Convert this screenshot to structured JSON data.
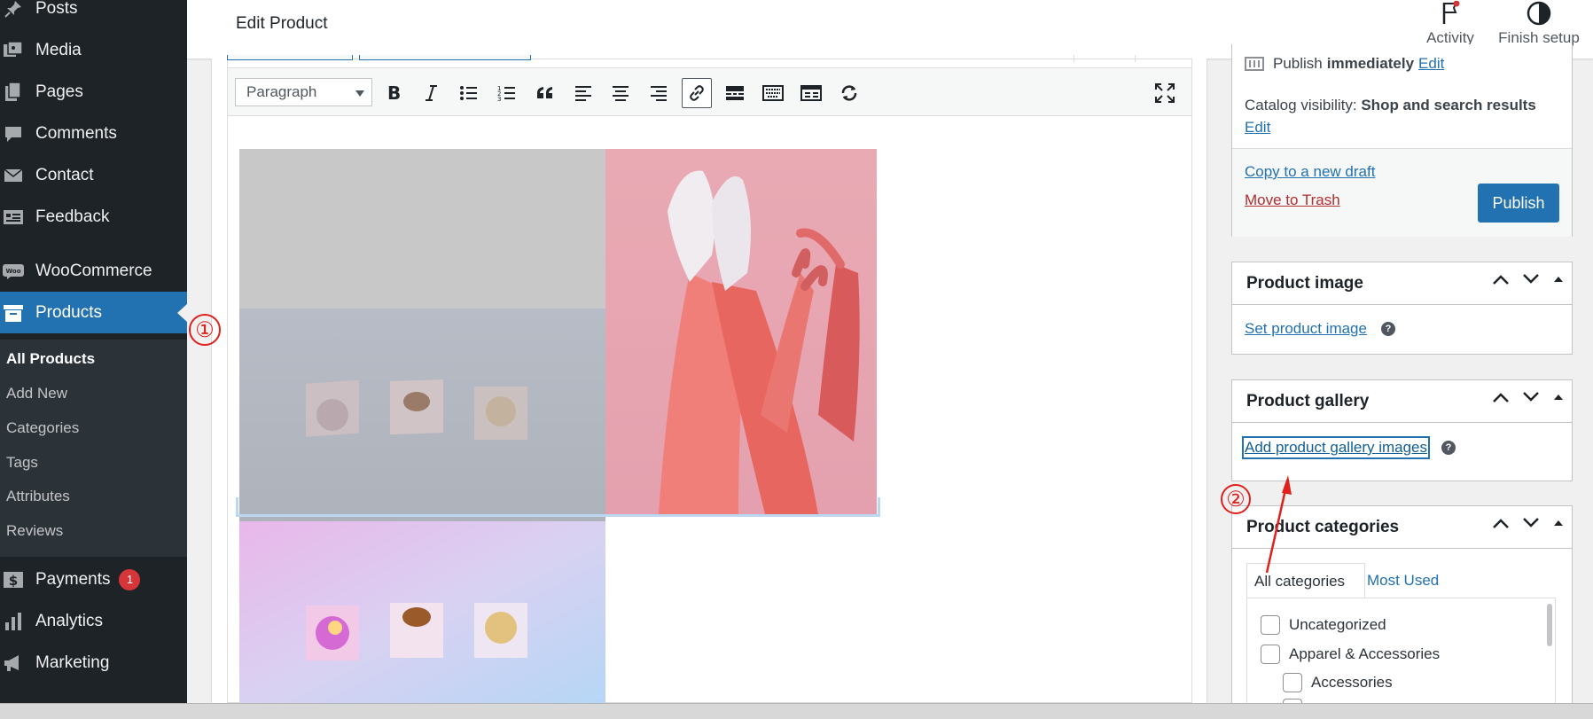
{
  "sidebar": {
    "items": [
      {
        "label": "Posts",
        "icon": "pin-icon"
      },
      {
        "label": "Media",
        "icon": "media-icon"
      },
      {
        "label": "Pages",
        "icon": "pages-icon"
      },
      {
        "label": "Comments",
        "icon": "comments-icon"
      },
      {
        "label": "Contact",
        "icon": "mail-icon"
      },
      {
        "label": "Feedback",
        "icon": "feedback-icon"
      },
      {
        "label": "WooCommerce",
        "icon": "woo-icon"
      },
      {
        "label": "Products",
        "icon": "archive-icon"
      },
      {
        "label": "Payments",
        "icon": "dollar-icon",
        "badge": "1"
      },
      {
        "label": "Analytics",
        "icon": "chart-icon"
      },
      {
        "label": "Marketing",
        "icon": "megaphone-icon"
      }
    ],
    "submenu": [
      "All Products",
      "Add New",
      "Categories",
      "Tags",
      "Attributes",
      "Reviews"
    ]
  },
  "topbar": {
    "title": "Edit Product",
    "activity": "Activity",
    "finish_setup": "Finish setup"
  },
  "editor": {
    "format_select": "Paragraph"
  },
  "publish": {
    "publish_label": "Publish",
    "immediately": "immediately",
    "edit": "Edit",
    "visibility_label": "Catalog visibility:",
    "visibility_value": "Shop and search results",
    "visibility_edit": "Edit",
    "copy_draft": "Copy to a new draft",
    "trash": "Move to Trash",
    "button": "Publish"
  },
  "product_image": {
    "title": "Product image",
    "link": "Set product image"
  },
  "product_gallery": {
    "title": "Product gallery",
    "link": "Add product gallery images"
  },
  "product_categories": {
    "title": "Product categories",
    "tab_all": "All categories",
    "tab_used": "Most Used",
    "items": [
      "Uncategorized",
      "Apparel & Accessories",
      "Accessories"
    ]
  },
  "annotations": {
    "one": "①",
    "two": "②"
  },
  "colors": {
    "accent": "#2271b1",
    "sidebar": "#1d2327",
    "annotation": "#e0201b"
  }
}
